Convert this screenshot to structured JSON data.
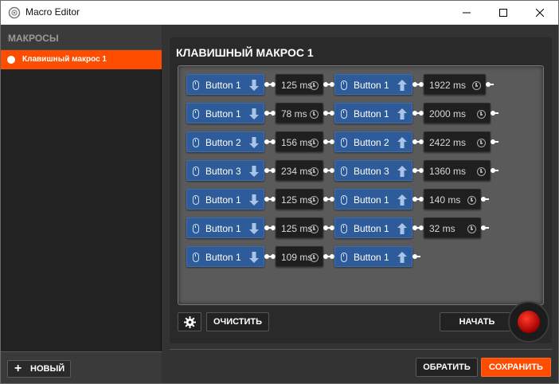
{
  "window": {
    "title": "Macro Editor",
    "minimize_icon": "minimize-icon",
    "maximize_icon": "maximize-icon",
    "close_icon": "close-icon"
  },
  "sidebar": {
    "title": "МАКРОСЫ",
    "items": [
      {
        "label": "Клавишный макрос 1",
        "selected": true
      }
    ],
    "new_button": {
      "icon": "+",
      "label": "НОВЫЙ"
    }
  },
  "editor": {
    "title": "КЛАВИШНЫЙ МАКРОС 1",
    "rows": [
      [
        {
          "type": "key",
          "label": "Button 1",
          "dir": "down"
        },
        {
          "type": "delay",
          "label": "125 ms"
        },
        {
          "type": "key",
          "label": "Button 1",
          "dir": "up"
        },
        {
          "type": "delay",
          "label": "1922 ms"
        }
      ],
      [
        {
          "type": "key",
          "label": "Button 1",
          "dir": "down"
        },
        {
          "type": "delay",
          "label": "78 ms"
        },
        {
          "type": "key",
          "label": "Button 1",
          "dir": "up"
        },
        {
          "type": "delay",
          "label": "2000 ms"
        }
      ],
      [
        {
          "type": "key",
          "label": "Button 2",
          "dir": "down"
        },
        {
          "type": "delay",
          "label": "156 ms"
        },
        {
          "type": "key",
          "label": "Button 2",
          "dir": "up"
        },
        {
          "type": "delay",
          "label": "2422 ms"
        }
      ],
      [
        {
          "type": "key",
          "label": "Button 3",
          "dir": "down"
        },
        {
          "type": "delay",
          "label": "234 ms"
        },
        {
          "type": "key",
          "label": "Button 3",
          "dir": "up"
        },
        {
          "type": "delay",
          "label": "1360 ms"
        }
      ],
      [
        {
          "type": "key",
          "label": "Button 1",
          "dir": "down"
        },
        {
          "type": "delay",
          "label": "125 ms"
        },
        {
          "type": "key",
          "label": "Button 1",
          "dir": "up"
        },
        {
          "type": "delay",
          "label": "140 ms"
        }
      ],
      [
        {
          "type": "key",
          "label": "Button 1",
          "dir": "down"
        },
        {
          "type": "delay",
          "label": "125 ms"
        },
        {
          "type": "key",
          "label": "Button 1",
          "dir": "up"
        },
        {
          "type": "delay",
          "label": "32 ms"
        }
      ],
      [
        {
          "type": "key",
          "label": "Button 1",
          "dir": "down"
        },
        {
          "type": "delay",
          "label": "109 ms"
        },
        {
          "type": "key",
          "label": "Button 1",
          "dir": "up"
        }
      ]
    ],
    "clear_label": "ОЧИСТИТЬ",
    "start_label": "НАЧАТЬ"
  },
  "footer": {
    "cancel_label": "ОБРАТИТЬ",
    "save_label": "СОХРАНИТЬ"
  },
  "colors": {
    "accent": "#ff4d00",
    "key_chip": "#2e5c9a",
    "delay_chip": "#1f1f1f",
    "record": "#d00000"
  }
}
